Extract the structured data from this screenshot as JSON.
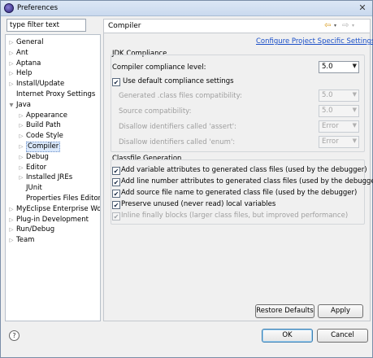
{
  "window": {
    "title": "Preferences",
    "close_glyph": "✕"
  },
  "filter": {
    "value": "type filter text"
  },
  "tree": {
    "items": [
      {
        "label": "General",
        "expandable": true
      },
      {
        "label": "Ant",
        "expandable": true
      },
      {
        "label": "Aptana",
        "expandable": true
      },
      {
        "label": "Help",
        "expandable": true
      },
      {
        "label": "Install/Update",
        "expandable": true
      },
      {
        "label": "Internet Proxy Settings",
        "expandable": false
      },
      {
        "label": "Java",
        "expandable": true,
        "expanded": true
      },
      {
        "label": "Appearance",
        "expandable": true
      },
      {
        "label": "Build Path",
        "expandable": true
      },
      {
        "label": "Code Style",
        "expandable": true
      },
      {
        "label": "Compiler",
        "expandable": true,
        "selected": true
      },
      {
        "label": "Debug",
        "expandable": true
      },
      {
        "label": "Editor",
        "expandable": true
      },
      {
        "label": "Installed JREs",
        "expandable": true
      },
      {
        "label": "JUnit",
        "expandable": false
      },
      {
        "label": "Properties Files Editor",
        "expandable": false
      },
      {
        "label": "MyEclipse Enterprise Wor",
        "expandable": true
      },
      {
        "label": "Plug-in Development",
        "expandable": true
      },
      {
        "label": "Run/Debug",
        "expandable": true
      },
      {
        "label": "Team",
        "expandable": true
      }
    ]
  },
  "page": {
    "title": "Compiler",
    "config_link": "Configure Project Specific Settings...",
    "nav": {
      "back_glyph": "⇦",
      "forward_glyph": "⇨",
      "dropdown_glyph": "▾"
    }
  },
  "jdk": {
    "section_label": "JDK Compliance",
    "compliance_label": "Compiler compliance level:",
    "compliance_value": "5.0",
    "use_default_label": "Use default compliance settings",
    "use_default_checked": true,
    "rows": [
      {
        "label": "Generated .class files compatibility:",
        "value": "5.0"
      },
      {
        "label": "Source compatibility:",
        "value": "5.0"
      },
      {
        "label": "Disallow identifiers called 'assert':",
        "value": "Error"
      },
      {
        "label": "Disallow identifiers called 'enum':",
        "value": "Error"
      }
    ]
  },
  "classfile": {
    "section_label": "Classfile Generation",
    "options": [
      {
        "label": "Add variable attributes to generated class files (used by the debugger)",
        "checked": true,
        "enabled": true
      },
      {
        "label": "Add line number attributes to generated class files (used by the debugger)",
        "checked": true,
        "enabled": true
      },
      {
        "label": "Add source file name to generated class file (used by the debugger)",
        "checked": true,
        "enabled": true
      },
      {
        "label": "Preserve unused (never read) local variables",
        "checked": true,
        "enabled": true
      },
      {
        "label": "Inline finally blocks (larger class files, but improved performance)",
        "checked": true,
        "enabled": false
      }
    ]
  },
  "buttons": {
    "restore_defaults": "Restore Defaults",
    "apply": "Apply",
    "ok": "OK",
    "cancel": "Cancel",
    "help_glyph": "?"
  },
  "colors": {
    "link": "#1a4fc8",
    "selection": "#dbe9fb",
    "back_arrow": "#d79b1c"
  }
}
